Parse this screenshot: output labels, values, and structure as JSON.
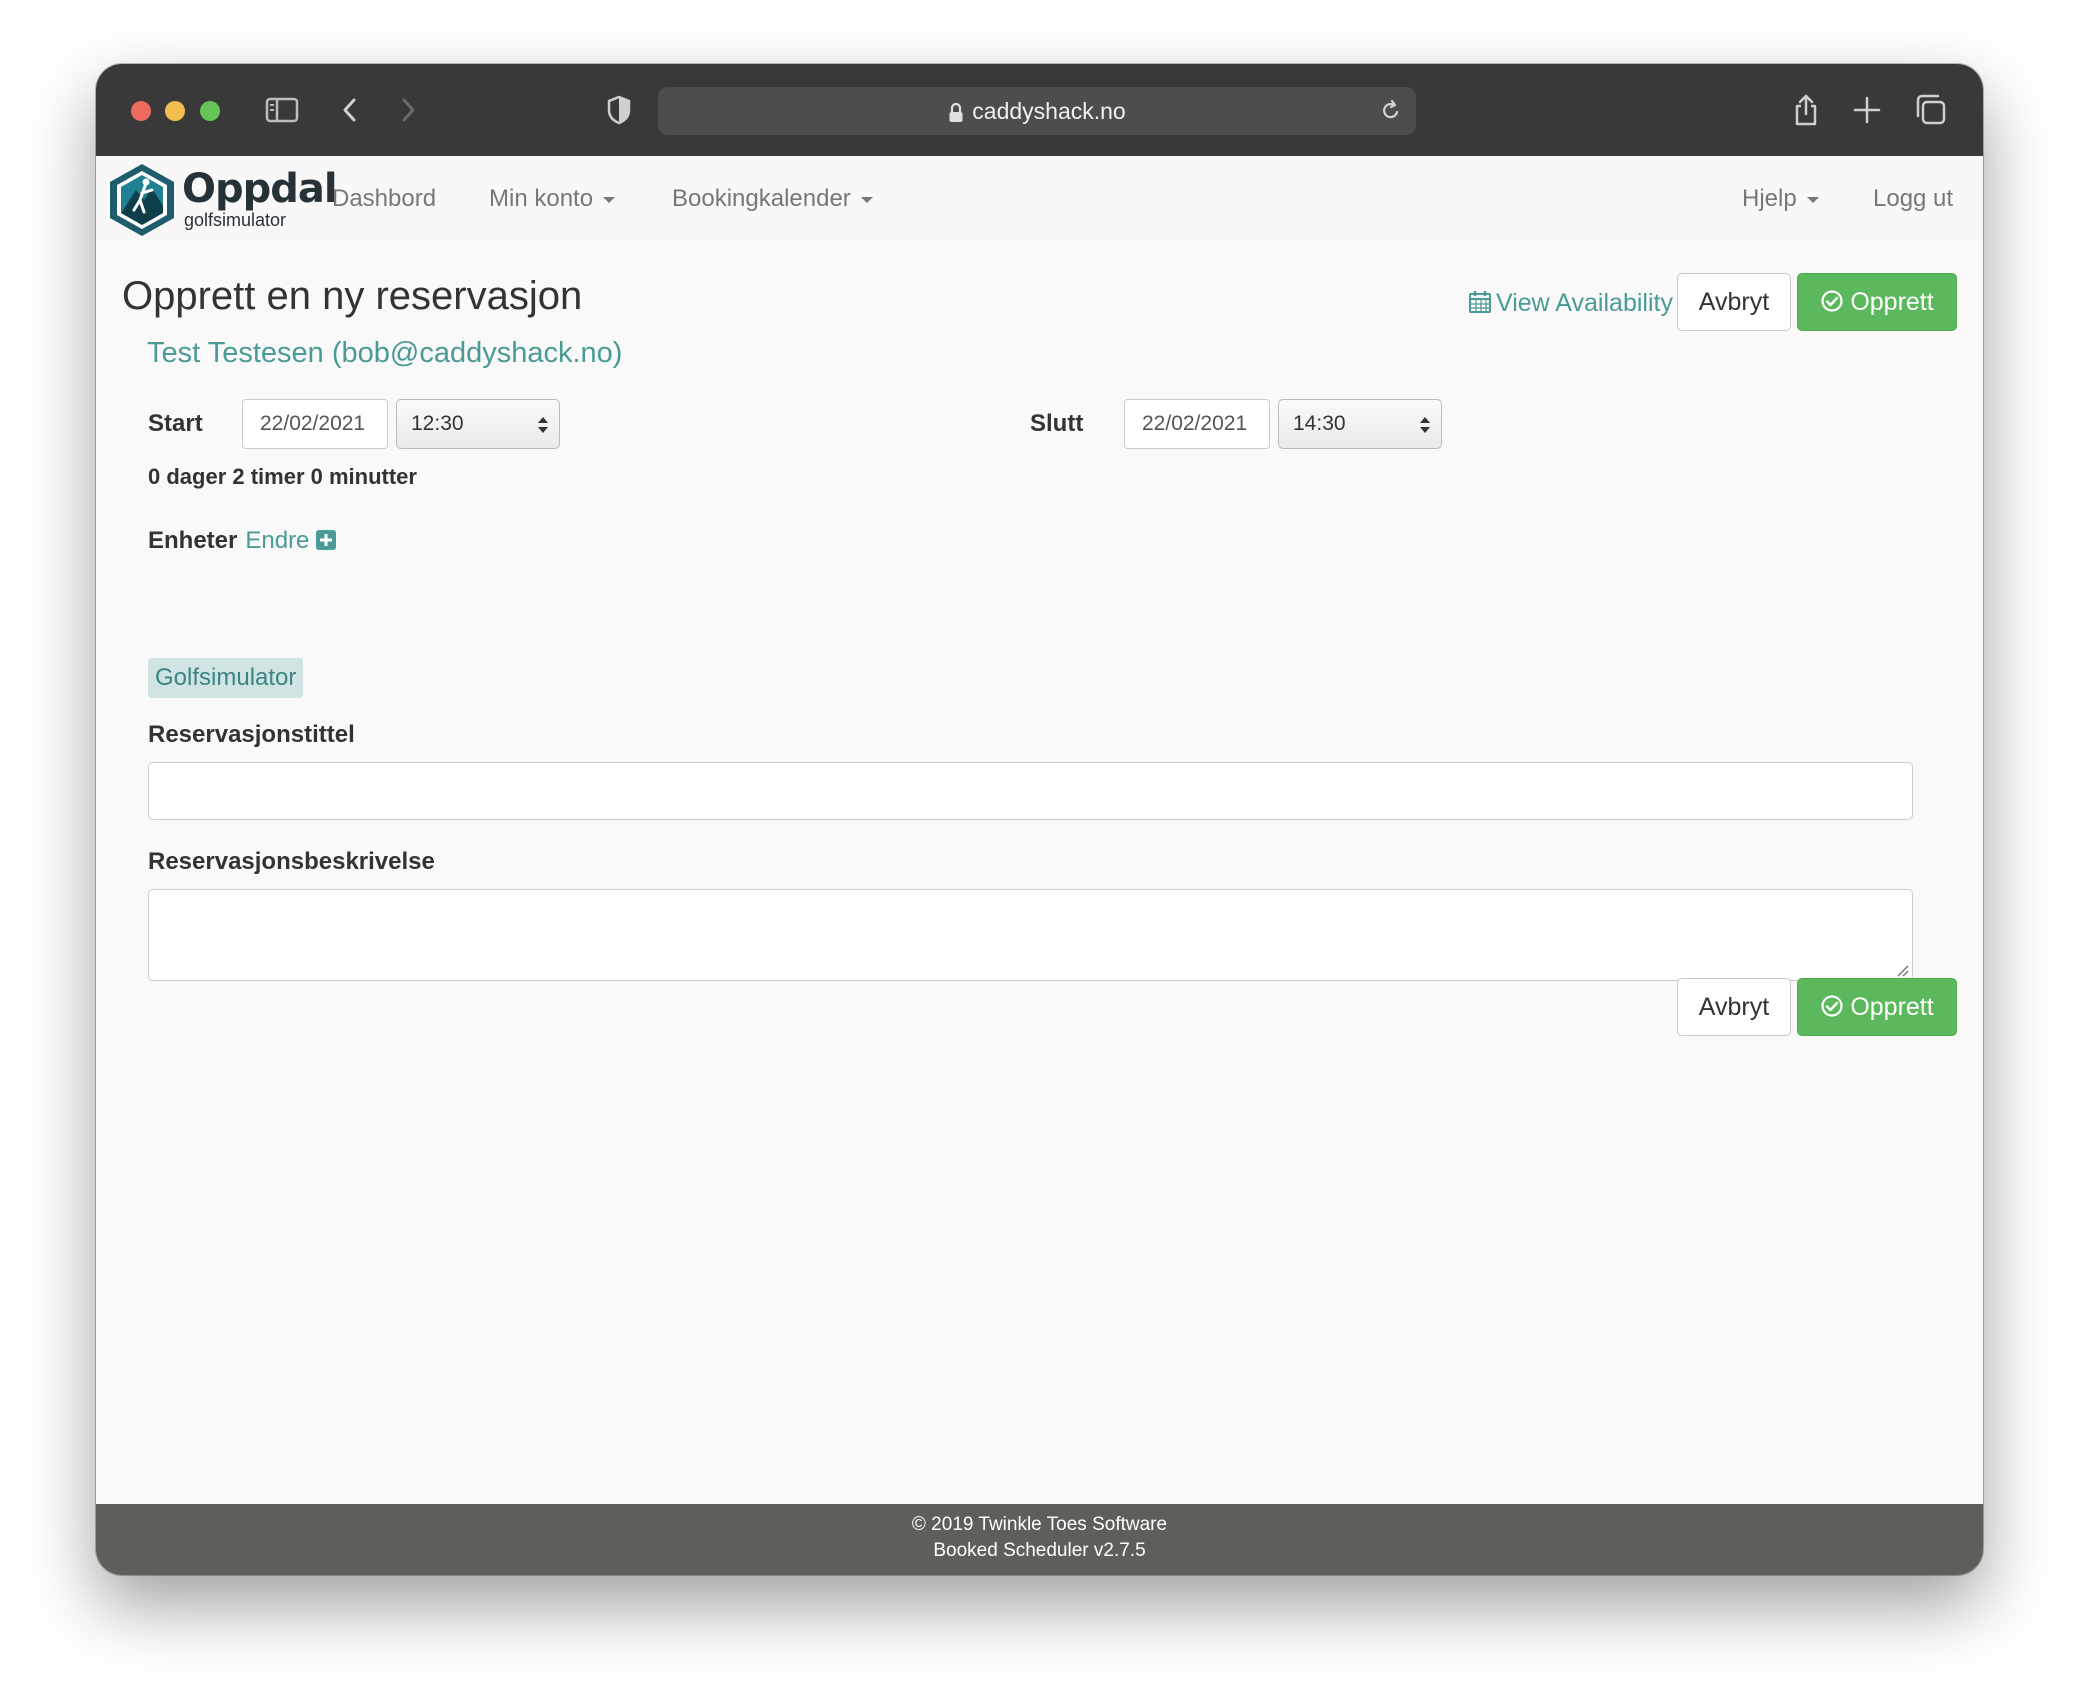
{
  "browser": {
    "url": "caddyshack.no"
  },
  "navbar": {
    "logo_title": "Oppdal",
    "logo_subtitle": "golfsimulator",
    "items": {
      "dashboard": "Dashbord",
      "my_account": "Min konto",
      "booking_calendar": "Bookingkalender",
      "help": "Hjelp",
      "logout": "Logg ut"
    }
  },
  "page": {
    "title": "Opprett en ny reservasjon",
    "user": "Test Testesen (bob@caddyshack.no)",
    "view_availability": "View Availability",
    "cancel_label": "Avbryt",
    "create_label": "Opprett"
  },
  "form": {
    "start_label": "Start",
    "start_date": "22/02/2021",
    "start_time": "12:30",
    "end_label": "Slutt",
    "end_date": "22/02/2021",
    "end_time": "14:30",
    "duration": "0 dager 2 timer 0 minutter",
    "resources_label": "Enheter",
    "resources_change": "Endre",
    "resource_name": "Golfsimulator",
    "title_label": "Reservasjonstittel",
    "title_value": "",
    "description_label": "Reservasjonsbeskrivelse",
    "description_value": ""
  },
  "footer": {
    "copyright": "© 2019 Twinkle Toes Software",
    "version": "Booked Scheduler v2.7.5"
  },
  "colors": {
    "accent": "#4a9a96",
    "success": "#5cb85c",
    "titlebar": "#393939",
    "footer": "#5e5e5b"
  },
  "icons": {
    "calendar": "calendar-icon",
    "check": "check-circle-icon",
    "plus": "plus-square-icon"
  }
}
